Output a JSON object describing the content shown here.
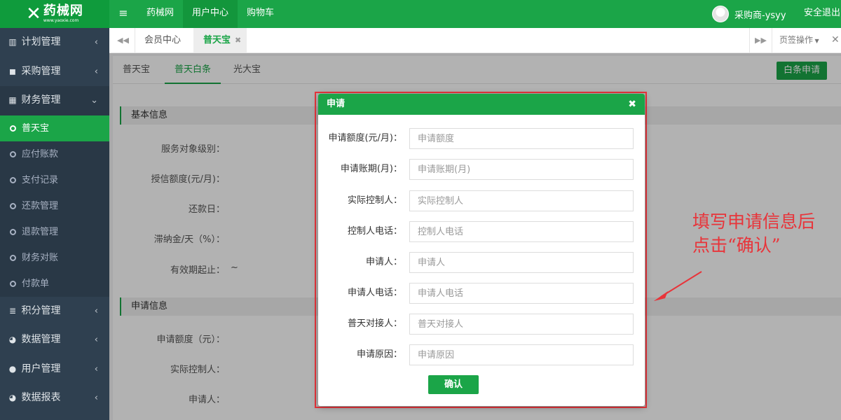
{
  "header": {
    "logo_mark": "✕",
    "logo_cn": "药械网",
    "logo_url": "www.yaoxie.com",
    "menu_icon": "menu-icon",
    "nav": [
      {
        "label": "药械网",
        "active": false
      },
      {
        "label": "用户中心",
        "active": true
      },
      {
        "label": "购物车",
        "active": false
      }
    ],
    "user_name": "采购商-ysyy",
    "security_label": "安全退出"
  },
  "sidebar": {
    "groups": [
      {
        "icon": "bar-chart-icon",
        "label": "计划管理",
        "open": false
      },
      {
        "icon": "shopping-bag-icon",
        "label": "采购管理",
        "open": false
      },
      {
        "icon": "calculator-icon",
        "label": "财务管理",
        "open": true,
        "children": [
          {
            "label": "普天宝",
            "active": true
          },
          {
            "label": "应付账款",
            "active": false
          },
          {
            "label": "支付记录",
            "active": false
          },
          {
            "label": "还款管理",
            "active": false
          },
          {
            "label": "退款管理",
            "active": false
          },
          {
            "label": "财务对账",
            "active": false
          },
          {
            "label": "付款单",
            "active": false
          }
        ]
      },
      {
        "icon": "database-icon",
        "label": "积分管理",
        "open": false
      },
      {
        "icon": "pie-chart-icon",
        "label": "数据管理",
        "open": false
      },
      {
        "icon": "user-icon",
        "label": "用户管理",
        "open": false
      },
      {
        "icon": "pie-chart-icon",
        "label": "数据报表",
        "open": false
      }
    ]
  },
  "tabs": {
    "items": [
      {
        "label": "会员中心",
        "active": false
      },
      {
        "label": "普天宝",
        "active": true
      }
    ],
    "ops_label": "页签操作"
  },
  "main": {
    "subtabs": [
      {
        "label": "普天宝",
        "active": false
      },
      {
        "label": "普天白条",
        "active": true
      },
      {
        "label": "光大宝",
        "active": false
      }
    ],
    "apply_button": "白条申请",
    "section_basic": "基本信息",
    "basic_fields": [
      "服务对象级别：",
      "授信额度(元/月)：",
      "还款日：",
      "滞纳金/天（%）：",
      "有效期起止："
    ],
    "validity_tilde": "~",
    "section_apply": "申请信息",
    "apply_fields": [
      "申请额度（元）：",
      "实际控制人：",
      "申请人："
    ]
  },
  "modal": {
    "title": "申请",
    "fields": [
      {
        "label": "申请额度(元/月)：",
        "placeholder": "申请额度",
        "value": ""
      },
      {
        "label": "申请账期(月)：",
        "placeholder": "申请账期(月)",
        "value": ""
      },
      {
        "label": "实际控制人：",
        "placeholder": "实际控制人",
        "value": ""
      },
      {
        "label": "控制人电话：",
        "placeholder": "控制人电话",
        "value": ""
      },
      {
        "label": "申请人：",
        "placeholder": "申请人",
        "value": ""
      },
      {
        "label": "申请人电话：",
        "placeholder": "申请人电话",
        "value": ""
      },
      {
        "label": "普天对接人：",
        "placeholder": "普天对接人",
        "value": ""
      },
      {
        "label": "申请原因：",
        "placeholder": "申请原因",
        "value": ""
      }
    ],
    "confirm_label": "确认"
  },
  "annotation": {
    "line1": "填写申请信息后",
    "line2": "点击“确认”"
  },
  "colors": {
    "brand_green": "#1ba548",
    "sidebar_bg": "#2f4050",
    "annotation_red": "#e8343a"
  }
}
